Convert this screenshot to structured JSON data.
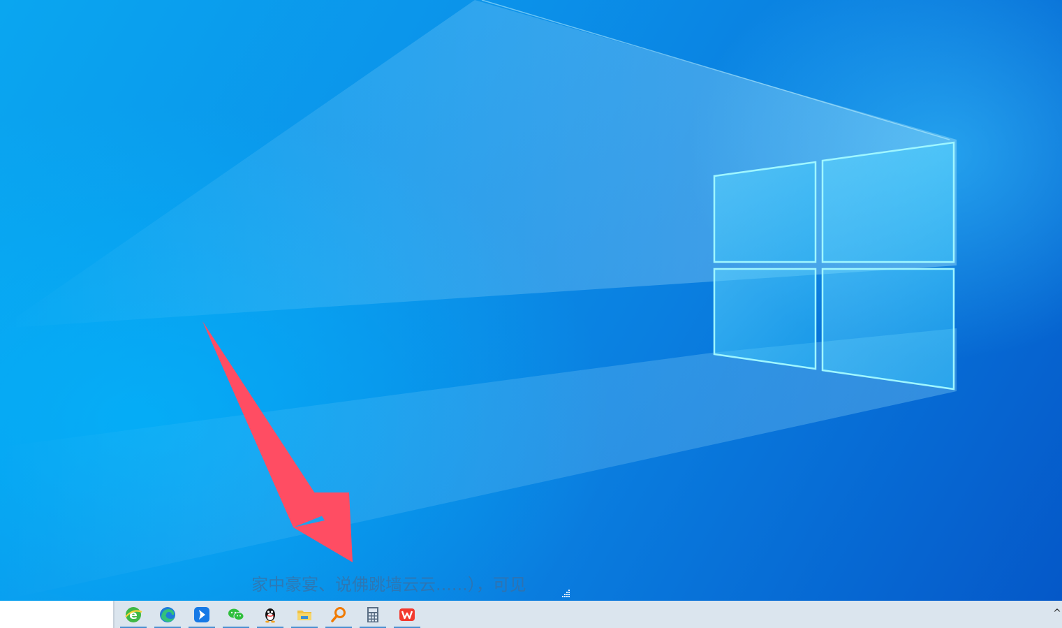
{
  "desktop": {
    "wallpaper": "windows-10-hero",
    "accent_colors": {
      "sky": "#0aa6f0",
      "deep": "#0558c8",
      "glow": "#7fe9ff"
    },
    "overlay_text": "家中豪宴、说佛跳墙云云......），可见",
    "arrow_color": "#ff4d63"
  },
  "taskbar": {
    "background": "#dbe5ee",
    "pinned_apps": [
      {
        "name": "360-browser",
        "icon": "browser-e-icon"
      },
      {
        "name": "microsoft-edge",
        "icon": "edge-icon"
      },
      {
        "name": "feishu-arrow-app",
        "icon": "blue-arrow-app-icon"
      },
      {
        "name": "wechat",
        "icon": "wechat-icon"
      },
      {
        "name": "qq",
        "icon": "qq-penguin-icon"
      },
      {
        "name": "file-explorer",
        "icon": "folder-icon"
      },
      {
        "name": "search-tool",
        "icon": "magnifier-icon"
      },
      {
        "name": "calculator",
        "icon": "calculator-icon"
      },
      {
        "name": "wps-office",
        "icon": "wps-icon"
      }
    ],
    "tray_chevron": "^"
  }
}
